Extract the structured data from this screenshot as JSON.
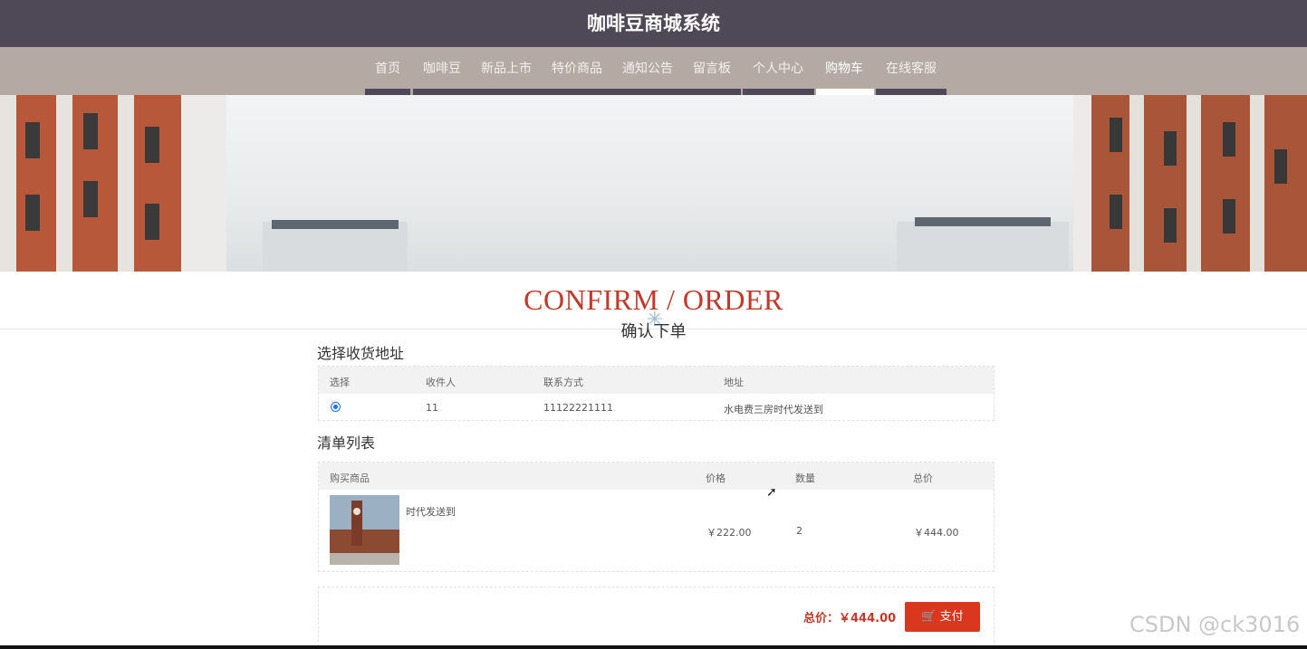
{
  "site": {
    "title": "咖啡豆商城系统"
  },
  "nav": {
    "items": [
      {
        "label": "首页"
      },
      {
        "label": "咖啡豆"
      },
      {
        "label": "新品上市"
      },
      {
        "label": "特价商品"
      },
      {
        "label": "通知公告"
      },
      {
        "label": "留言板"
      },
      {
        "label": "个人中心"
      },
      {
        "label": "购物车"
      },
      {
        "label": "在线客服"
      }
    ],
    "active": "购物车"
  },
  "page": {
    "title_en": "CONFIRM / ORDER",
    "title_cn": "确认下单"
  },
  "address": {
    "section_title": "选择收货地址",
    "headers": {
      "select": "选择",
      "recipient": "收件人",
      "contact": "联系方式",
      "address": "地址"
    },
    "rows": [
      {
        "selected": true,
        "recipient": "11",
        "contact": "11122221111",
        "address": "水电费三房时代发送到"
      }
    ]
  },
  "order_list": {
    "section_title": "清单列表",
    "headers": {
      "product": "购买商品",
      "price": "价格",
      "quantity": "数量",
      "total": "总价"
    },
    "rows": [
      {
        "name": "时代发送到",
        "price": "￥222.00",
        "quantity": "2",
        "total": "￥444.00"
      }
    ]
  },
  "summary": {
    "total_label": "总价：￥444.00",
    "pay_label": "支付"
  },
  "colors": {
    "topbar": "#4f4856",
    "navbar": "#b5a9a3",
    "accent": "#c0392b",
    "pay_button": "#d9381e"
  },
  "watermark": "CSDN @ck3016"
}
